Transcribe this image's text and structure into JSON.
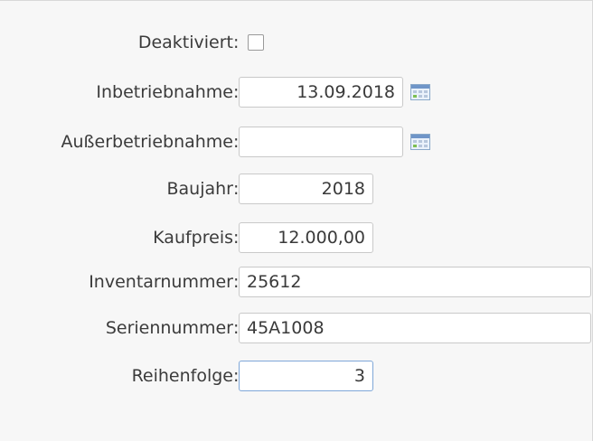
{
  "form": {
    "deaktiviert_label": "Deaktiviert",
    "deaktiviert_checked": false,
    "inbetriebnahme_label": "Inbetriebnahme",
    "inbetriebnahme_value": "13.09.2018",
    "ausserbetriebnahme_label": "Außerbetriebnahme",
    "ausserbetriebnahme_value": "",
    "baujahr_label": "Baujahr",
    "baujahr_value": "2018",
    "kaufpreis_label": "Kaufpreis",
    "kaufpreis_value": "12.000,00",
    "inventarnummer_label": "Inventarnummer",
    "inventarnummer_value": "25612",
    "seriennummer_label": "Seriennummer",
    "seriennummer_value": "45A1008",
    "reihenfolge_label": "Reihenfolge",
    "reihenfolge_value": "3",
    "colon": ":"
  },
  "icons": {
    "calendar": "calendar-icon",
    "checkbox": "checkbox-icon"
  },
  "colors": {
    "panel_bg": "#f7f7f7",
    "input_border": "#c9c9c9",
    "focus_border": "#7fa7d8",
    "calendar_accent": "#6f95c8"
  }
}
